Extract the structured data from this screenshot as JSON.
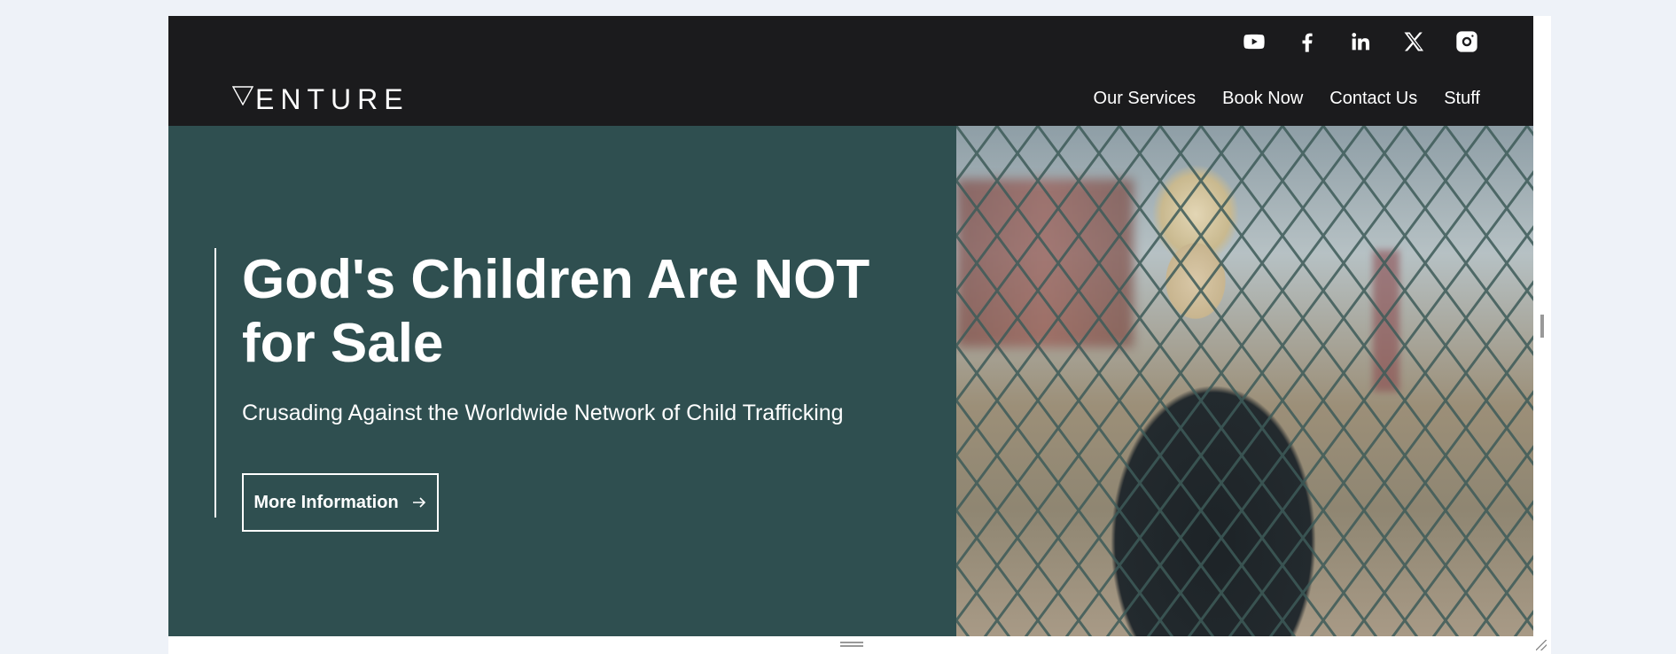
{
  "social": [
    {
      "name": "youtube-icon"
    },
    {
      "name": "facebook-icon"
    },
    {
      "name": "linkedin-icon"
    },
    {
      "name": "x-icon"
    },
    {
      "name": "instagram-icon"
    }
  ],
  "logo": {
    "text": "ENTURE"
  },
  "nav": {
    "items": [
      "Our Services",
      "Book Now",
      "Contact Us",
      "Stuff"
    ]
  },
  "hero": {
    "headline": "God's Children Are NOT for Sale",
    "subheadline": "Crusading Against the Worldwide Network of Child Trafficking",
    "cta_label": "More Information",
    "bg_color": "#2f4f50",
    "image_alt": "child behind chain-link fence"
  },
  "colors": {
    "header_bg": "#1b1b1d",
    "hero_bg": "#2f4f50",
    "text": "#ffffff",
    "page_bg": "#eef2f8"
  }
}
